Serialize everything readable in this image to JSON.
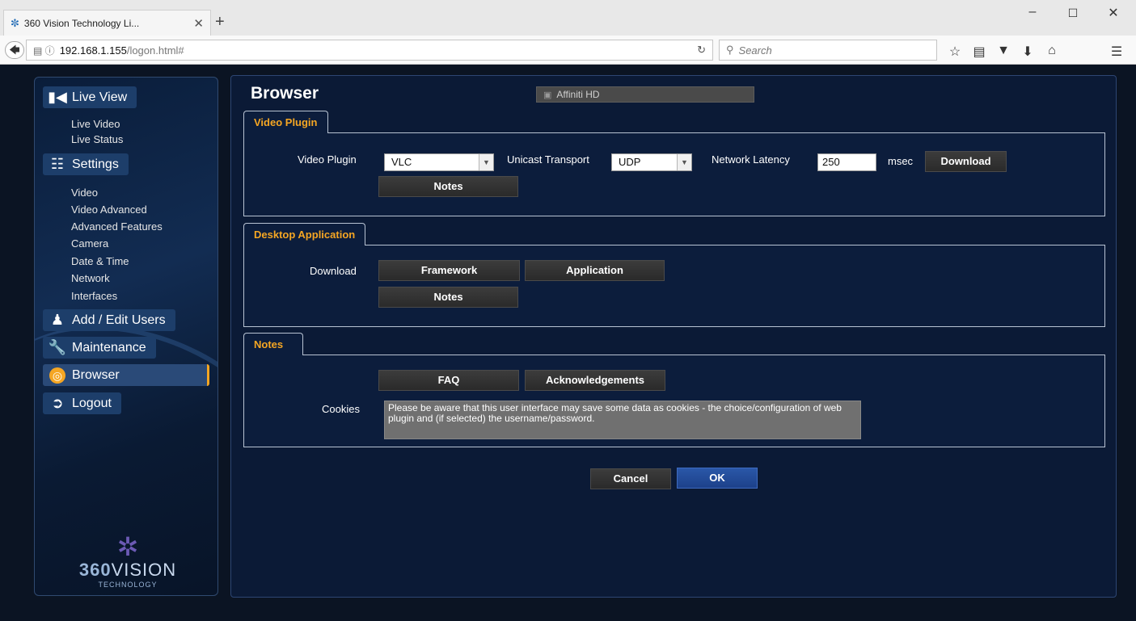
{
  "browser": {
    "tab_title": "360 Vision Technology Li...",
    "url_host": "192.168.1.155",
    "url_path": "/logon.html#",
    "search_placeholder": "Search"
  },
  "sidebar": {
    "live_view": "Live View",
    "live_view_items": [
      "Live Video",
      "Live Status"
    ],
    "settings": "Settings",
    "settings_items": [
      "Video",
      "Video Advanced",
      "Advanced Features",
      "Camera",
      "Date & Time",
      "Network",
      "Interfaces"
    ],
    "add_edit_users": "Add / Edit Users",
    "maintenance": "Maintenance",
    "browser": "Browser",
    "logout": "Logout",
    "logo_brand_a": "360",
    "logo_brand_b": "VISION",
    "logo_tag": "TECHNOLOGY"
  },
  "main": {
    "title": "Browser",
    "camera_name": "Affiniti HD",
    "video_plugin_section": {
      "tab": "Video Plugin",
      "plugin_label": "Video Plugin",
      "plugin_value": "VLC",
      "transport_label": "Unicast Transport",
      "transport_value": "UDP",
      "latency_label": "Network Latency",
      "latency_value": "250",
      "latency_unit": "msec",
      "download_button": "Download",
      "notes_button": "Notes"
    },
    "desktop_section": {
      "tab": "Desktop Application",
      "download_label": "Download",
      "framework_button": "Framework",
      "application_button": "Application",
      "notes_button": "Notes"
    },
    "notes_section": {
      "tab": "Notes",
      "faq_button": "FAQ",
      "ack_button": "Acknowledgements",
      "cookies_label": "Cookies",
      "cookies_text": "Please be aware that this user interface may save some data as cookies - the choice/configuration of web plugin and (if selected) the username/password."
    },
    "cancel_button": "Cancel",
    "ok_button": "OK"
  },
  "colors": {
    "accent": "#f5a623",
    "ok_button": "#2a57a8",
    "background": "#0b1423"
  }
}
